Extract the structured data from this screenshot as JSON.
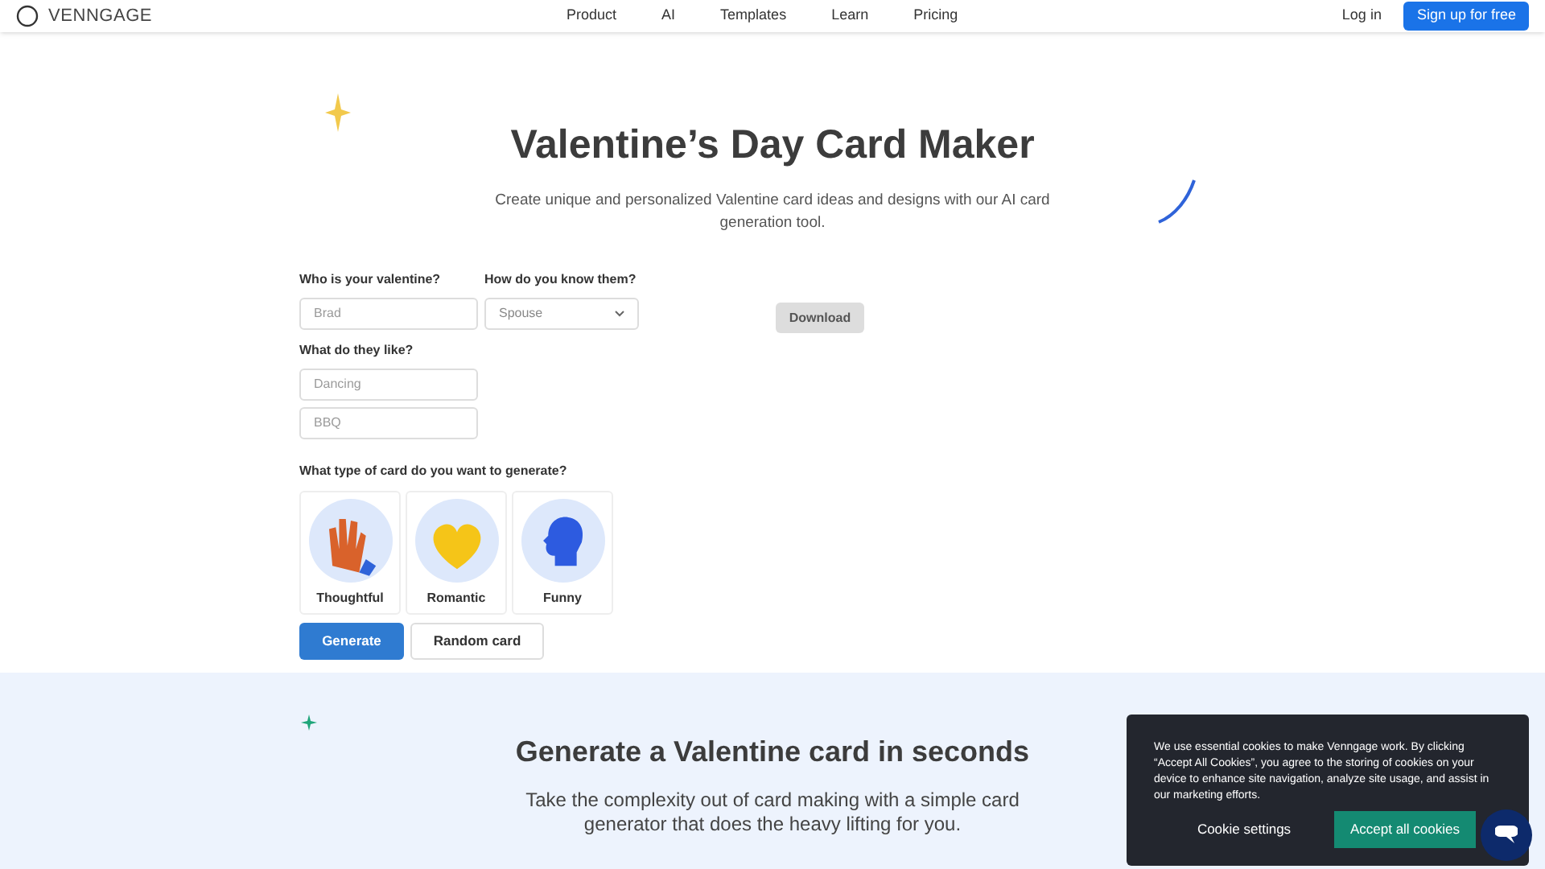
{
  "nav": {
    "logo": "VENNGAGE",
    "links": [
      "Product",
      "AI",
      "Templates",
      "Learn",
      "Pricing"
    ],
    "login": "Log in",
    "signup": "Sign up for free"
  },
  "hero": {
    "title": "Valentine’s Day Card Maker",
    "subtitle": "Create unique and personalized Valentine card ideas and designs with our AI card generation tool."
  },
  "form": {
    "who_label": "Who is your valentine?",
    "who_placeholder": "Brad",
    "know_label": "How do you know them?",
    "know_value": "Spouse",
    "like_label": "What do they like?",
    "like_placeholders": [
      "Dancing",
      "BBQ"
    ],
    "type_label": "What type of card do you want to generate?",
    "card_types": [
      {
        "kind": "hands",
        "label": "Thoughtful"
      },
      {
        "kind": "heart",
        "label": "Romantic"
      },
      {
        "kind": "head",
        "label": "Funny"
      }
    ],
    "generate": "Generate",
    "random": "Random card"
  },
  "download": "Download",
  "section": {
    "title": "Generate a Valentine card in seconds",
    "text": "Take the complexity out of card making with a simple card generator that does the heavy lifting for you."
  },
  "cookie": {
    "text": "We use essential cookies to make Venngage work. By clicking “Accept All Cookies”, you agree to the storing of cookies on your device to enhance site navigation, analyze site usage, and assist in our marketing efforts.",
    "settings": "Cookie settings",
    "accept": "Accept all cookies"
  }
}
